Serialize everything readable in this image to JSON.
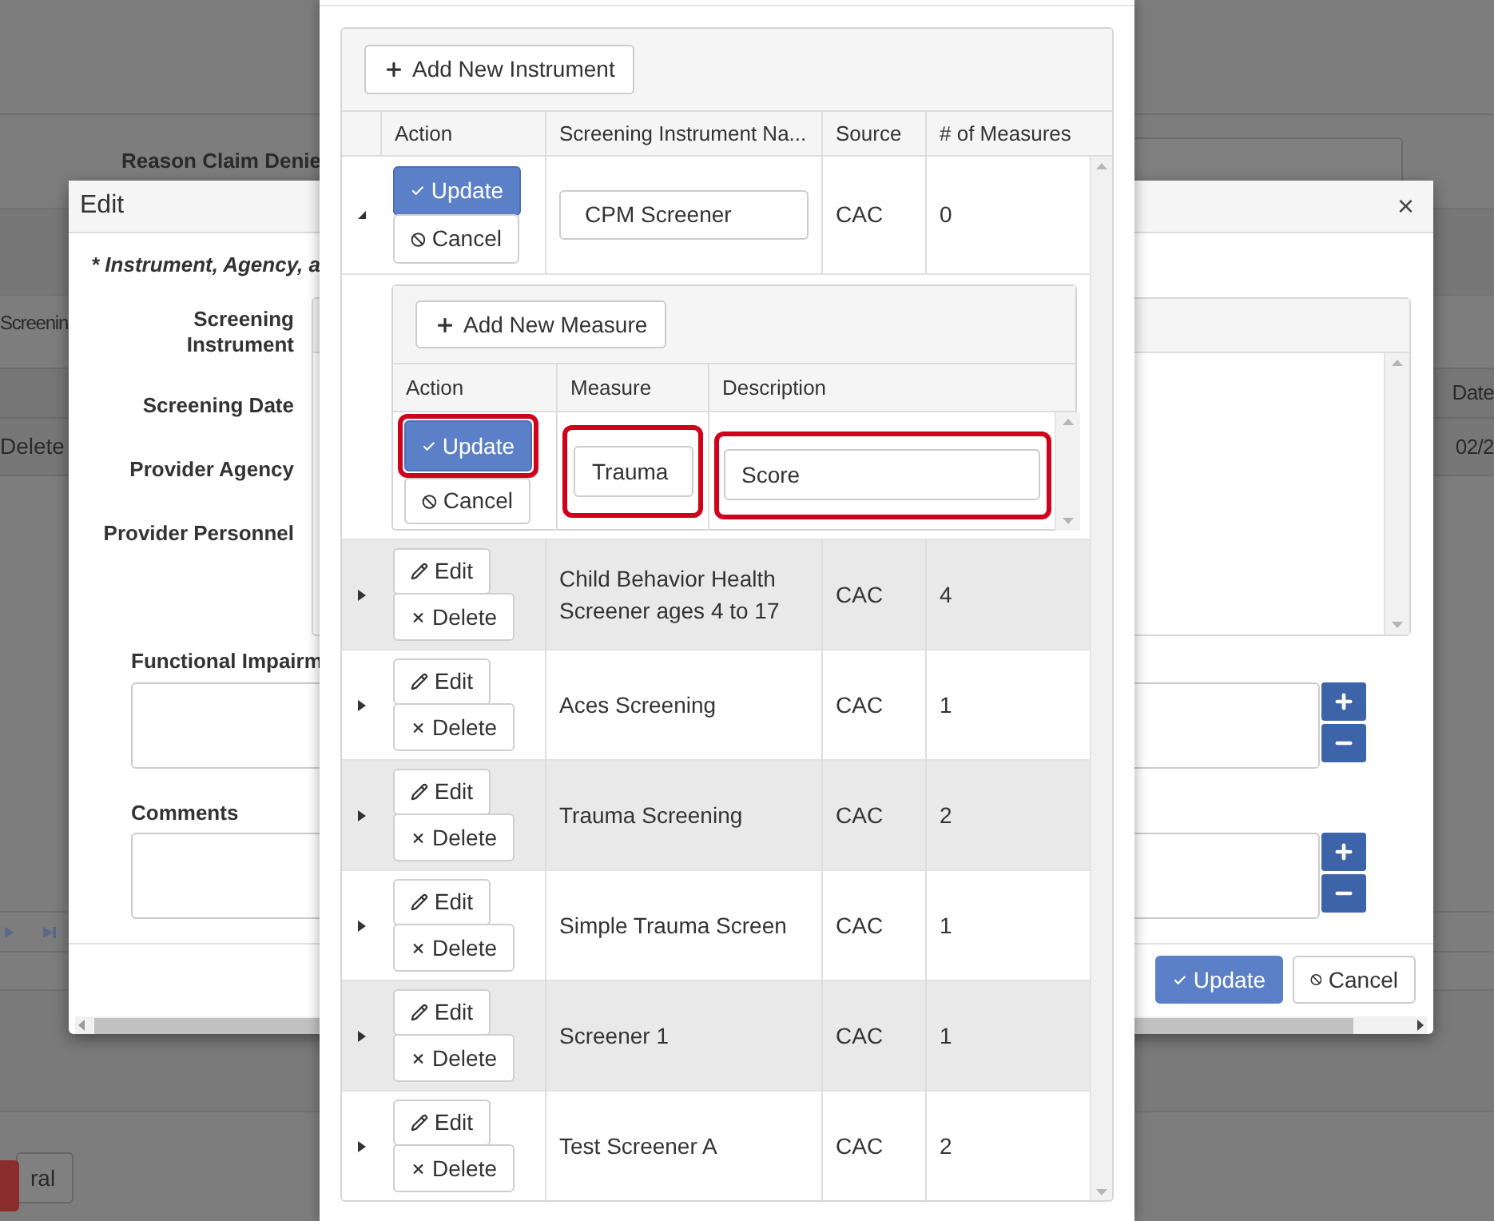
{
  "background_page": {
    "reason_label": "Reason Claim Denie",
    "row_text": "Screenin",
    "delete_text": "Delete",
    "date_header": "Date",
    "date_cell": "02/2",
    "bottom_button": "ral"
  },
  "edit_dialog": {
    "title": "Edit",
    "close": "×",
    "required_note": "* Instrument, Agency, a",
    "fields": [
      {
        "label": "Screening Instrument"
      },
      {
        "label": "Screening Date"
      },
      {
        "label": "Provider Agency"
      },
      {
        "label": "Provider Personnel"
      }
    ],
    "functional_impairment": {
      "label": "Functional Impairm"
    },
    "comments": {
      "label": "Comments"
    },
    "buttons": [
      {
        "label": "Update",
        "primary": true
      },
      {
        "label": "Cancel",
        "primary": false
      }
    ]
  },
  "instrument_dialog": {
    "add_button": "Add New Instrument",
    "columns": [
      "Action",
      "Screening Instrument Na...",
      "Source",
      "# of Measures"
    ],
    "rows": [
      {
        "kind": "editing",
        "expanded": true,
        "actions": [
          {
            "label": "Update",
            "primary": true
          },
          {
            "label": "Cancel",
            "primary": false
          }
        ],
        "name": "CPM Screener",
        "source": "CAC",
        "measures": "0",
        "detail": {
          "add_button": "Add New Measure",
          "columns": [
            "Action",
            "Measure",
            "Description"
          ],
          "row": {
            "actions": [
              {
                "label": "Update",
                "primary": true,
                "highlighted": true
              },
              {
                "label": "Cancel",
                "primary": false,
                "highlighted": false
              }
            ],
            "measure": {
              "value": "Trauma",
              "highlighted": true
            },
            "description": {
              "value": "Score",
              "highlighted": true
            }
          }
        }
      },
      {
        "kind": "view",
        "expanded": false,
        "actions": [
          {
            "label": "Edit"
          },
          {
            "label": "Delete"
          }
        ],
        "name": "Child Behavior Health Screener ages 4 to 17",
        "source": "CAC",
        "measures": "4"
      },
      {
        "kind": "view",
        "expanded": false,
        "actions": [
          {
            "label": "Edit"
          },
          {
            "label": "Delete"
          }
        ],
        "name": "Aces Screening",
        "source": "CAC",
        "measures": "1"
      },
      {
        "kind": "view",
        "expanded": false,
        "actions": [
          {
            "label": "Edit"
          },
          {
            "label": "Delete"
          }
        ],
        "name": "Trauma Screening",
        "source": "CAC",
        "measures": "2"
      },
      {
        "kind": "view",
        "expanded": false,
        "actions": [
          {
            "label": "Edit"
          },
          {
            "label": "Delete"
          }
        ],
        "name": "Simple Trauma Screen",
        "source": "CAC",
        "measures": "1"
      },
      {
        "kind": "view",
        "expanded": false,
        "actions": [
          {
            "label": "Edit"
          },
          {
            "label": "Delete"
          }
        ],
        "name": "Screener 1",
        "source": "CAC",
        "measures": "1"
      },
      {
        "kind": "view",
        "expanded": false,
        "actions": [
          {
            "label": "Edit"
          },
          {
            "label": "Delete"
          }
        ],
        "name": "Test Screener A",
        "source": "CAC",
        "measures": "2"
      }
    ]
  }
}
